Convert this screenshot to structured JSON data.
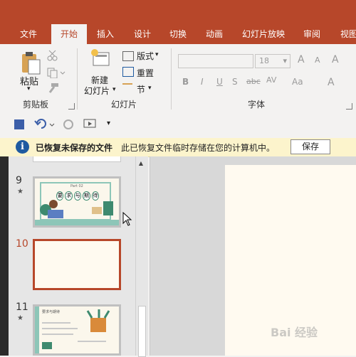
{
  "tabs": [
    {
      "label": "文件",
      "active": false
    },
    {
      "label": "开始",
      "active": true
    },
    {
      "label": "插入",
      "active": false
    },
    {
      "label": "设计",
      "active": false
    },
    {
      "label": "切换",
      "active": false
    },
    {
      "label": "动画",
      "active": false
    },
    {
      "label": "幻灯片放映",
      "active": false
    },
    {
      "label": "审阅",
      "active": false
    },
    {
      "label": "视图",
      "active": false
    }
  ],
  "ribbon": {
    "clipboard": {
      "group_label": "剪贴板",
      "paste_label": "粘贴",
      "paste_arrow": "▾"
    },
    "slides": {
      "group_label": "幻灯片",
      "new_slide_line1": "新建",
      "new_slide_line2": "幻灯片",
      "layout_label": "版式",
      "reset_label": "重置",
      "section_label": "节"
    },
    "font": {
      "group_label": "字体",
      "font_size": "18",
      "bold": "B",
      "italic": "I",
      "underline": "U",
      "shadow": "S",
      "strike": "abc",
      "spacing": "AV",
      "case": "Aa",
      "grow": "A",
      "shrink": "A",
      "clear": "A"
    }
  },
  "qat": {
    "more": "▾"
  },
  "message_bar": {
    "title": "已恢复未保存的文件",
    "text": "此已恢复文件临时存储在您的计算机中。",
    "button": "保存",
    "info_glyph": "i"
  },
  "slides_panel": {
    "slides": [
      {
        "number": "9",
        "starred": true,
        "title_bits": [
          "要",
          "求",
          "与",
          "期",
          "待"
        ],
        "caption": "Part 02"
      },
      {
        "number": "10",
        "starred": false,
        "selected": true
      },
      {
        "number": "11",
        "starred": true,
        "heading": "要求与期待"
      }
    ],
    "star_glyph": "★"
  },
  "watermark": "Bai 经验",
  "colors": {
    "accent": "#b7472a",
    "message_bg": "#fcf4cc",
    "info_blue": "#1e5aa0"
  }
}
